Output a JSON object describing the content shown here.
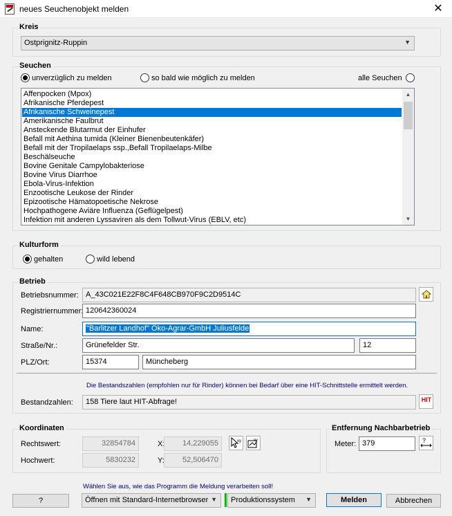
{
  "window": {
    "title": "neues Seuchenobjekt melden",
    "close_glyph": "✕"
  },
  "kreis": {
    "group_title": "Kreis",
    "selected": "Ostprignitz-Ruppin"
  },
  "seuchen": {
    "group_title": "Seuchen",
    "radio_sofort": "unverzüglich zu melden",
    "radio_bald": "so bald wie möglich zu melden",
    "radio_alle": "alle Seuchen",
    "selected_radio": "sofort",
    "items": [
      "Affenpocken (Mpox)",
      "Afrikanische Pferdepest",
      "Afrikanische Schweinepest",
      "Amerikanische Faulbrut",
      "Ansteckende Blutarmut der Einhufer",
      "Befall mit Aethina tumida (Kleiner Bienenbeutenkäfer)",
      "Befall mit der Tropilaelaps ssp.,Befall Tropilaelaps-Milbe",
      "Beschälseuche",
      "Bovine Genitale Campylobakteriose",
      "Bovine Virus Diarrhoe",
      "Ebola-Virus-Infektion",
      "Enzootische Leukose der Rinder",
      "Epizootische Hämatopoetische Nekrose",
      "Hochpathogene Aviäre Influenza (Geflügelpest)",
      "Infektion mit anderen Lyssaviren als dem Tollwut-Virus (EBLV, etc)"
    ],
    "selected_index": 2
  },
  "kulturform": {
    "group_title": "Kulturform",
    "radio_gehalten": "gehalten",
    "radio_wild": "wild lebend",
    "selected": "gehalten"
  },
  "betrieb": {
    "group_title": "Betrieb",
    "betriebsnummer_label": "Betriebsnummer:",
    "betriebsnummer": "A_43C021E22F8C4F648CB970F9C2D9514C",
    "registriernummer_label": "Registriernummer:",
    "registriernummer": "120642360024",
    "name_label": "Name:",
    "name": "\"Barlitzer Landhof\" Öko-Agrar-GmbH Juliusfelde",
    "strasse_label": "Straße/Nr.:",
    "strasse": "Grünefelder Str.",
    "hausnummer": "12",
    "plzort_label": "PLZ/Ort:",
    "plz": "15374",
    "ort": "Müncheberg",
    "bestand_note": "Die Bestandszahlen (empfohlen nur für Rinder) können bei Bedarf über eine HIT-Schnittstelle ermittelt werden.",
    "bestand_label": "Bestandzahlen:",
    "bestand": "158 Tiere laut HIT-Abfrage!",
    "hit_button": "HIT"
  },
  "koordinaten": {
    "group_title": "Koordinaten",
    "rechtswert_label": "Rechtswert:",
    "rechtswert": "32854784",
    "hochwert_label": "Hochwert:",
    "hochwert": "5830232",
    "x_label": "X:",
    "x": "14,229055",
    "y_label": "Y:",
    "y": "52,506470"
  },
  "entfernung": {
    "group_title": "Entfernung Nachbarbetrieb",
    "meter_label": "Meter:",
    "meter": "379"
  },
  "footer": {
    "note": "Wählen Sie aus, wie das Programm die Meldung verarbeiten soll!",
    "help_button": "?",
    "open_mode": "Öffnen mit Standard-Internetbrowser",
    "system": "Produktionssystem",
    "melden_button": "Melden",
    "abbrechen_button": "Abbrechen"
  },
  "colors": {
    "selection": "#0078d7",
    "system_indicator": "#00c000",
    "note_text": "#000080"
  }
}
